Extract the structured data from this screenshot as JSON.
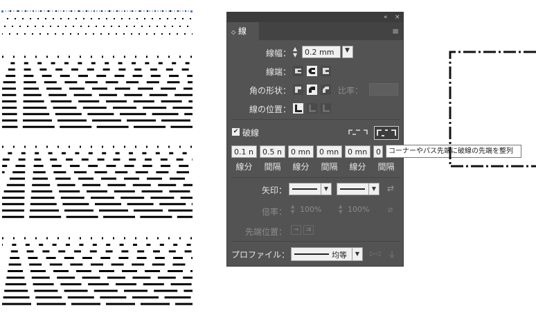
{
  "panel": {
    "tab_label": "線",
    "tab_chevron": "◇",
    "collapse_icon": "«",
    "close_icon": "×",
    "menu_icon": "≡",
    "weight_label": "線幅：",
    "weight_value": "0.2 mm",
    "cap_label": "線端：",
    "corner_label": "角の形状：",
    "ratio_label": "比率：",
    "align_label": "線の位置：",
    "dashed_label": "破線",
    "dash_fields": [
      {
        "value": "0.1 n",
        "label": "線分"
      },
      {
        "value": "0.5 n",
        "label": "間隔"
      },
      {
        "value": "0 mn",
        "label": "線分"
      },
      {
        "value": "0 mn",
        "label": "間隔"
      },
      {
        "value": "0 mn",
        "label": "線分"
      },
      {
        "value": "0",
        "label": "間隔"
      }
    ],
    "arrow_label": "矢印：",
    "scale_label": "倍率：",
    "scale_values": [
      "100%",
      "100%"
    ],
    "tip_label": "先端位置：",
    "profile_label": "プロファイル：",
    "profile_value": "均等"
  },
  "tooltip": "コーナーやパス先端に破線の先端を整列",
  "colors": {
    "panel_bg": "#535353",
    "selection_blue": "#4a7bd6"
  }
}
